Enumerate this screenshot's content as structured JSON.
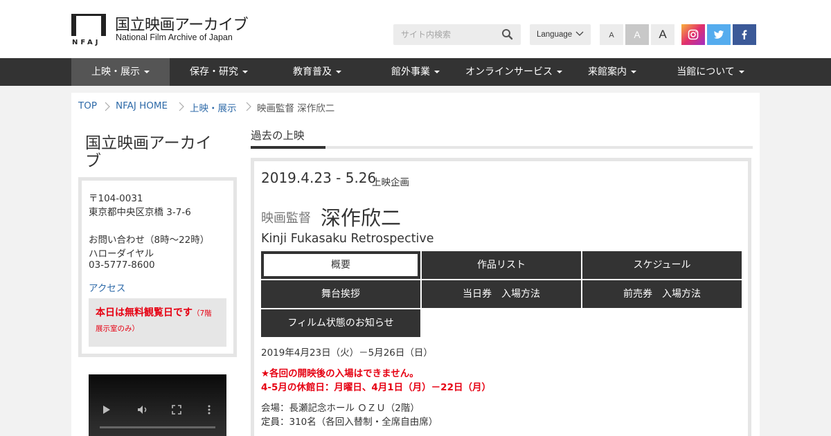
{
  "header": {
    "logo_ja": "国立映画アーカイブ",
    "logo_en": "National Film Archive of Japan",
    "search_placeholder": "サイト内検索",
    "language_label": "Language",
    "font_sizes": [
      "A",
      "A",
      "A"
    ],
    "sns": [
      "instagram-icon",
      "twitter-icon",
      "facebook-icon"
    ]
  },
  "nav": {
    "items": [
      {
        "label": "上映・展示"
      },
      {
        "label": "保存・研究"
      },
      {
        "label": "教育普及"
      },
      {
        "label": "館外事業"
      },
      {
        "label": "オンラインサービス"
      },
      {
        "label": "来館案内"
      },
      {
        "label": "当館について"
      }
    ]
  },
  "breadcrumb": [
    "TOP",
    "NFAJ HOME",
    "上映・展示",
    "映画監督 深作欣二"
  ],
  "sidebar": {
    "title": "国立映画アーカイブ",
    "postal": "〒104-0031",
    "address": "東京都中央区京橋 3-7-6",
    "contact_label": "お問い合わせ（8時～22時）",
    "dial_name": "ハローダイヤル",
    "phone": "03-5777-8600",
    "access_link": "アクセス",
    "free_main": "本日は無料観覧日です",
    "free_sub_1": "（7階",
    "free_sub_2": "展示室のみ）"
  },
  "main": {
    "section_title": "過去の上映",
    "date": "2019.4.23 - 5.26",
    "date_tag": "上映企画",
    "title_pre": "映画監督",
    "title_main": "深作欣二",
    "title_en": "Kinji Fukasaku Retrospective",
    "tabs": [
      "概要",
      "作品リスト",
      "スケジュール",
      "舞台挨拶",
      "当日券　入場方法",
      "前売券　入場方法",
      "フィルム状態のお知らせ"
    ],
    "period": "2019年4月23日（火）－5月26日（日）",
    "notice_1": "★各回の開映後の入場はできません。",
    "notice_2": "4-5月の休館日：月曜日、4月1日（月）－22日（月）",
    "venue": "会場：長瀬記念ホール ＯＺＵ（2階）",
    "capacity": "定員：310名（各回入替制・全席自由席）"
  }
}
